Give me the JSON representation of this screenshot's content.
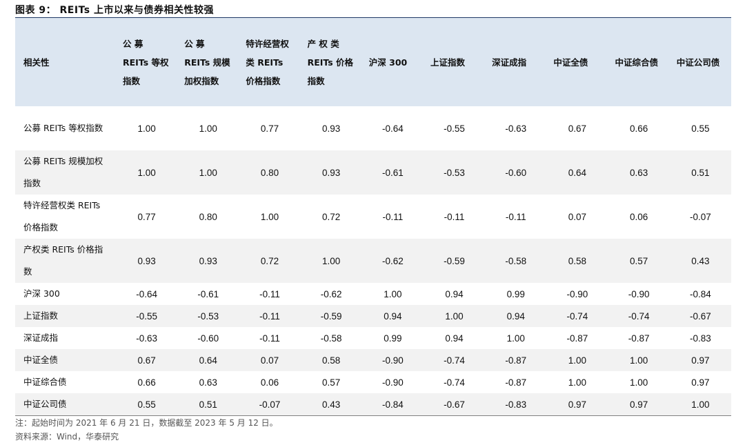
{
  "figure": {
    "title": "图表 9：   REITs 上市以来与债券相关性较强"
  },
  "table": {
    "corner_header": "相关性",
    "columns": [
      "公 募 REITs 等权指数",
      "公 募 REITs 规模加权指数",
      "特许经营权 类 REITs 价格指数",
      "产 权 类 REITs 价格指数",
      "沪深 300",
      "上证指数",
      "深证成指",
      "中证全债",
      "中证综合债",
      "中证公司债"
    ],
    "rows": [
      {
        "label": "公募 REITs 等权指数",
        "values": [
          "1.00",
          "1.00",
          "0.77",
          "0.93",
          "-0.64",
          "-0.55",
          "-0.63",
          "0.67",
          "0.66",
          "0.55"
        ]
      },
      {
        "label": "公募 REITs 规模加权指数",
        "values": [
          "1.00",
          "1.00",
          "0.80",
          "0.93",
          "-0.61",
          "-0.53",
          "-0.60",
          "0.64",
          "0.63",
          "0.51"
        ]
      },
      {
        "label": "特许经营权类 REITs 价格指数",
        "values": [
          "0.77",
          "0.80",
          "1.00",
          "0.72",
          "-0.11",
          "-0.11",
          "-0.11",
          "0.07",
          "0.06",
          "-0.07"
        ]
      },
      {
        "label": "产权类 REITs 价格指数",
        "values": [
          "0.93",
          "0.93",
          "0.72",
          "1.00",
          "-0.62",
          "-0.59",
          "-0.58",
          "0.58",
          "0.57",
          "0.43"
        ]
      },
      {
        "label": "沪深 300",
        "values": [
          "-0.64",
          "-0.61",
          "-0.11",
          "-0.62",
          "1.00",
          "0.94",
          "0.99",
          "-0.90",
          "-0.90",
          "-0.84"
        ]
      },
      {
        "label": "上证指数",
        "values": [
          "-0.55",
          "-0.53",
          "-0.11",
          "-0.59",
          "0.94",
          "1.00",
          "0.94",
          "-0.74",
          "-0.74",
          "-0.67"
        ]
      },
      {
        "label": "深证成指",
        "values": [
          "-0.63",
          "-0.60",
          "-0.11",
          "-0.58",
          "0.99",
          "0.94",
          "1.00",
          "-0.87",
          "-0.87",
          "-0.83"
        ]
      },
      {
        "label": "中证全债",
        "values": [
          "0.67",
          "0.64",
          "0.07",
          "0.58",
          "-0.90",
          "-0.74",
          "-0.87",
          "1.00",
          "1.00",
          "0.97"
        ]
      },
      {
        "label": "中证综合债",
        "values": [
          "0.66",
          "0.63",
          "0.06",
          "0.57",
          "-0.90",
          "-0.74",
          "-0.87",
          "1.00",
          "1.00",
          "0.97"
        ]
      },
      {
        "label": "中证公司债",
        "values": [
          "0.55",
          "0.51",
          "-0.07",
          "0.43",
          "-0.84",
          "-0.67",
          "-0.83",
          "0.97",
          "0.97",
          "1.00"
        ]
      }
    ]
  },
  "notes": {
    "note": "注：起始时间为 2021 年 6 月 21 日，数据截至 2023 年 5 月 12 日。",
    "source": "资料来源：Wind，华泰研究"
  }
}
